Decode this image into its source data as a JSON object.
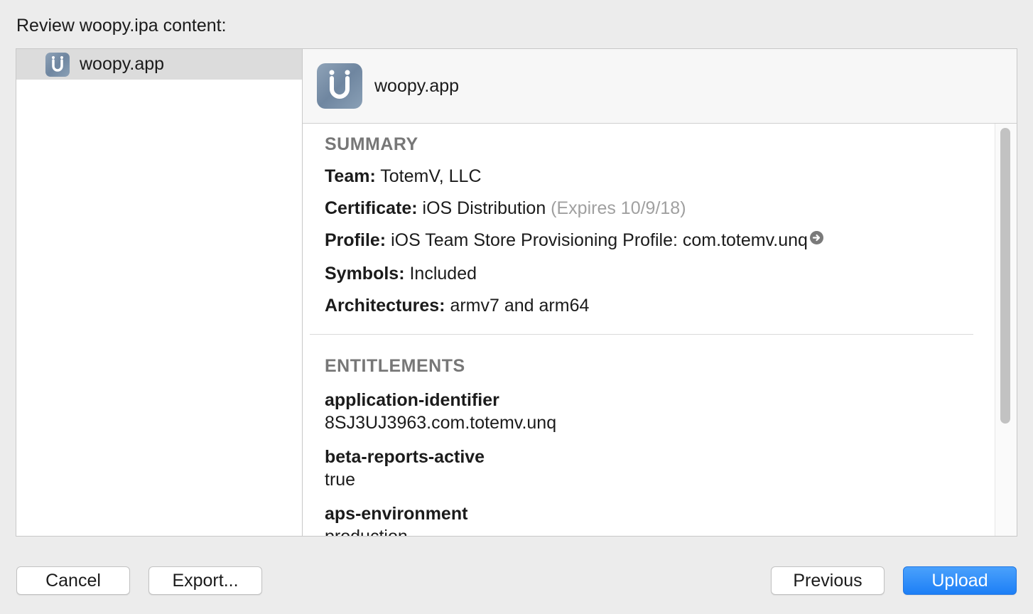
{
  "heading": "Review woopy.ipa content:",
  "sidebar": {
    "items": [
      {
        "label": "woopy.app",
        "icon": "app-icon",
        "selected": true
      }
    ]
  },
  "detail": {
    "title": "woopy.app",
    "summary": {
      "title": "SUMMARY",
      "team_label": "Team:",
      "team_value": "TotemV, LLC",
      "certificate_label": "Certificate:",
      "certificate_value": "iOS Distribution",
      "certificate_expiry": "(Expires 10/9/18)",
      "profile_label": "Profile:",
      "profile_value": "iOS Team Store Provisioning Profile: com.totemv.unq",
      "symbols_label": "Symbols:",
      "symbols_value": "Included",
      "architectures_label": "Architectures:",
      "architectures_value": "armv7 and arm64"
    },
    "entitlements": {
      "title": "ENTITLEMENTS",
      "items": [
        {
          "key": "application-identifier",
          "value": "8SJ3UJ3963.com.totemv.unq"
        },
        {
          "key": "beta-reports-active",
          "value": "true"
        },
        {
          "key": "aps-environment",
          "value": "production"
        }
      ]
    }
  },
  "buttons": {
    "cancel": "Cancel",
    "export": "Export...",
    "previous": "Previous",
    "upload": "Upload"
  },
  "colors": {
    "accent": "#1d7ff6",
    "section_title": "#777777",
    "muted": "#a0a0a0"
  }
}
